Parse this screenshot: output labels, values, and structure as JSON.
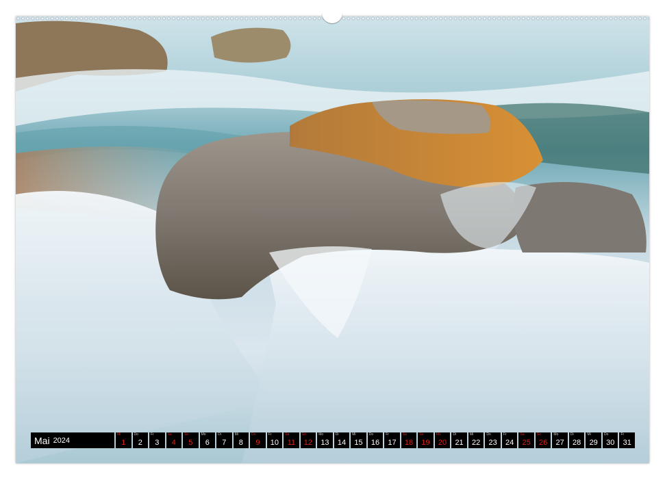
{
  "calendar": {
    "month": "Mai",
    "year": "2024",
    "days": [
      {
        "dow": "Mi",
        "num": "1",
        "red": true
      },
      {
        "dow": "Do",
        "num": "2",
        "red": false
      },
      {
        "dow": "Fr",
        "num": "3",
        "red": false
      },
      {
        "dow": "Sa",
        "num": "4",
        "red": true
      },
      {
        "dow": "So",
        "num": "5",
        "red": true
      },
      {
        "dow": "Mo",
        "num": "6",
        "red": false
      },
      {
        "dow": "Di",
        "num": "7",
        "red": false
      },
      {
        "dow": "Mi",
        "num": "8",
        "red": false
      },
      {
        "dow": "Do",
        "num": "9",
        "red": true
      },
      {
        "dow": "Fr",
        "num": "10",
        "red": false
      },
      {
        "dow": "Sa",
        "num": "11",
        "red": true
      },
      {
        "dow": "So",
        "num": "12",
        "red": true
      },
      {
        "dow": "Mo",
        "num": "13",
        "red": false
      },
      {
        "dow": "Di",
        "num": "14",
        "red": false
      },
      {
        "dow": "Mi",
        "num": "15",
        "red": false
      },
      {
        "dow": "Do",
        "num": "16",
        "red": false
      },
      {
        "dow": "Fr",
        "num": "17",
        "red": false
      },
      {
        "dow": "Sa",
        "num": "18",
        "red": true
      },
      {
        "dow": "So",
        "num": "19",
        "red": true
      },
      {
        "dow": "Mo",
        "num": "20",
        "red": true
      },
      {
        "dow": "Di",
        "num": "21",
        "red": false
      },
      {
        "dow": "Mi",
        "num": "22",
        "red": false
      },
      {
        "dow": "Do",
        "num": "23",
        "red": false
      },
      {
        "dow": "Fr",
        "num": "24",
        "red": false
      },
      {
        "dow": "Sa",
        "num": "25",
        "red": true
      },
      {
        "dow": "So",
        "num": "26",
        "red": true
      },
      {
        "dow": "Mo",
        "num": "27",
        "red": false
      },
      {
        "dow": "Di",
        "num": "28",
        "red": false
      },
      {
        "dow": "Mi",
        "num": "29",
        "red": false
      },
      {
        "dow": "Do",
        "num": "30",
        "red": false
      },
      {
        "dow": "Fr",
        "num": "31",
        "red": false
      }
    ]
  },
  "colors": {
    "holiday_red": "#e0201a",
    "strip_black": "#000000",
    "water_blue": "#7fb6c8",
    "rock_gray": "#8a8580",
    "lichen_orange": "#c9822e"
  }
}
